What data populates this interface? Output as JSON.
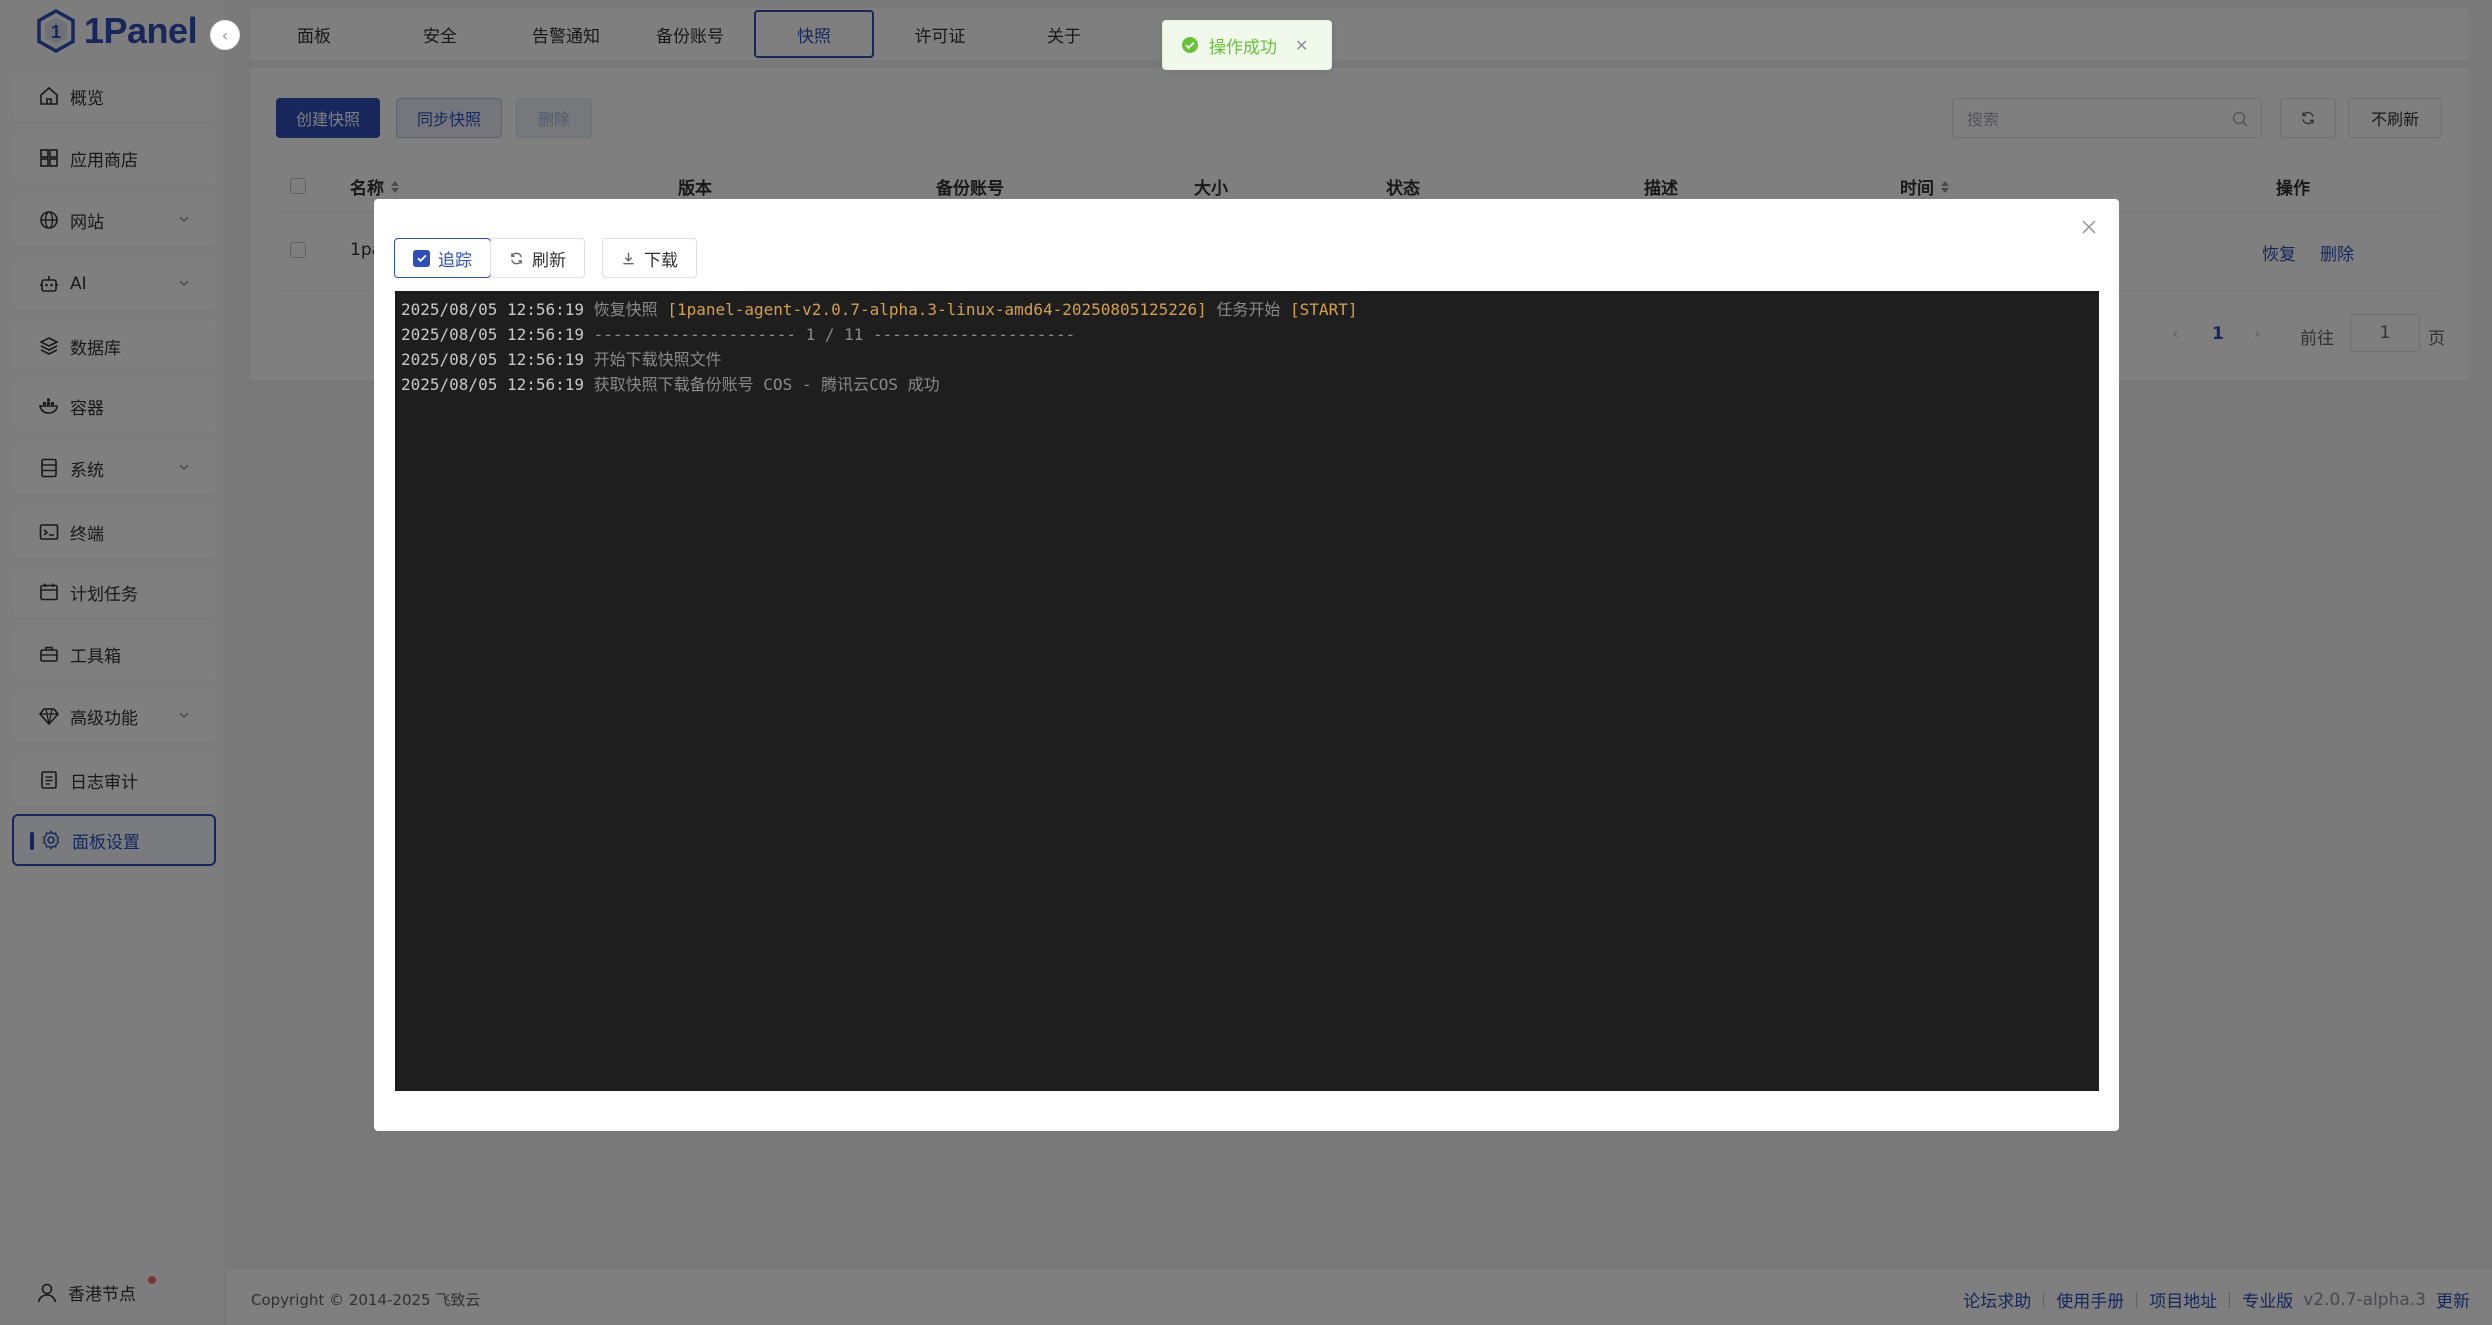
{
  "app": {
    "logo_text": "1Panel"
  },
  "sidebar": {
    "items": [
      {
        "label": "概览",
        "icon": "home-icon",
        "expandable": false
      },
      {
        "label": "应用商店",
        "icon": "grid-icon",
        "expandable": false
      },
      {
        "label": "网站",
        "icon": "globe-icon",
        "expandable": true
      },
      {
        "label": "AI",
        "icon": "robot-icon",
        "expandable": true
      },
      {
        "label": "数据库",
        "icon": "database-layers-icon",
        "expandable": false
      },
      {
        "label": "容器",
        "icon": "docker-icon",
        "expandable": false
      },
      {
        "label": "系统",
        "icon": "server-icon",
        "expandable": true
      },
      {
        "label": "终端",
        "icon": "terminal-icon",
        "expandable": false
      },
      {
        "label": "计划任务",
        "icon": "calendar-icon",
        "expandable": false
      },
      {
        "label": "工具箱",
        "icon": "toolbox-icon",
        "expandable": false
      },
      {
        "label": "高级功能",
        "icon": "diamond-icon",
        "expandable": true
      },
      {
        "label": "日志审计",
        "icon": "log-icon",
        "expandable": false
      },
      {
        "label": "面板设置",
        "icon": "gear-icon",
        "expandable": false,
        "active": true
      }
    ],
    "node_label": "香港节点"
  },
  "tabs": [
    {
      "label": "面板"
    },
    {
      "label": "安全"
    },
    {
      "label": "告警通知"
    },
    {
      "label": "备份账号"
    },
    {
      "label": "快照",
      "active": true
    },
    {
      "label": "许可证"
    },
    {
      "label": "关于"
    }
  ],
  "toolbar": {
    "create_label": "创建快照",
    "sync_label": "同步快照",
    "delete_label": "删除",
    "search_placeholder": "搜索",
    "refresh_select": "不刷新"
  },
  "table": {
    "columns": [
      "名称",
      "版本",
      "备份账号",
      "大小",
      "状态",
      "描述",
      "时间",
      "操作"
    ],
    "rows": [
      {
        "name": "1pa",
        "actions": [
          "恢复",
          "删除"
        ]
      }
    ]
  },
  "pagination": {
    "current": "1",
    "goto_label": "前往",
    "goto_value": "1",
    "page_suffix": "页"
  },
  "toast": {
    "message": "操作成功",
    "type": "success"
  },
  "dialog": {
    "buttons": {
      "follow": "追踪",
      "refresh": "刷新",
      "download": "下载"
    },
    "log_lines": [
      {
        "ts": "2025/08/05 12:56:19",
        "parts": [
          {
            "t": " 恢复快照 ",
            "c": "gray"
          },
          {
            "t": "[1panel-agent-v2.0.7-alpha.3-linux-amd64-20250805125226]",
            "c": "orange"
          },
          {
            "t": " 任务开始 ",
            "c": "gray"
          },
          {
            "t": "[START]",
            "c": "orange"
          }
        ]
      },
      {
        "ts": "2025/08/05 12:56:19",
        "parts": [
          {
            "t": " --------------------- 1 / 11 ---------------------",
            "c": "gray"
          }
        ]
      },
      {
        "ts": "2025/08/05 12:56:19",
        "parts": [
          {
            "t": " 开始下载快照文件",
            "c": "gray"
          }
        ]
      },
      {
        "ts": "2025/08/05 12:56:19",
        "parts": [
          {
            "t": " 获取快照下载备份账号 COS - 腾讯云COS 成功",
            "c": "gray"
          }
        ]
      }
    ]
  },
  "footer": {
    "copyright": "Copyright © 2014-2025 飞致云",
    "links": [
      "论坛求助",
      "使用手册",
      "项目地址",
      "专业版"
    ],
    "version": "v2.0.7-alpha.3",
    "update_label": "更新"
  },
  "colors": {
    "brand": "#2f4fb8",
    "success": "#67c23a",
    "terminal_bg": "#1e1e1e",
    "log_highlight": "#d4a04a"
  }
}
